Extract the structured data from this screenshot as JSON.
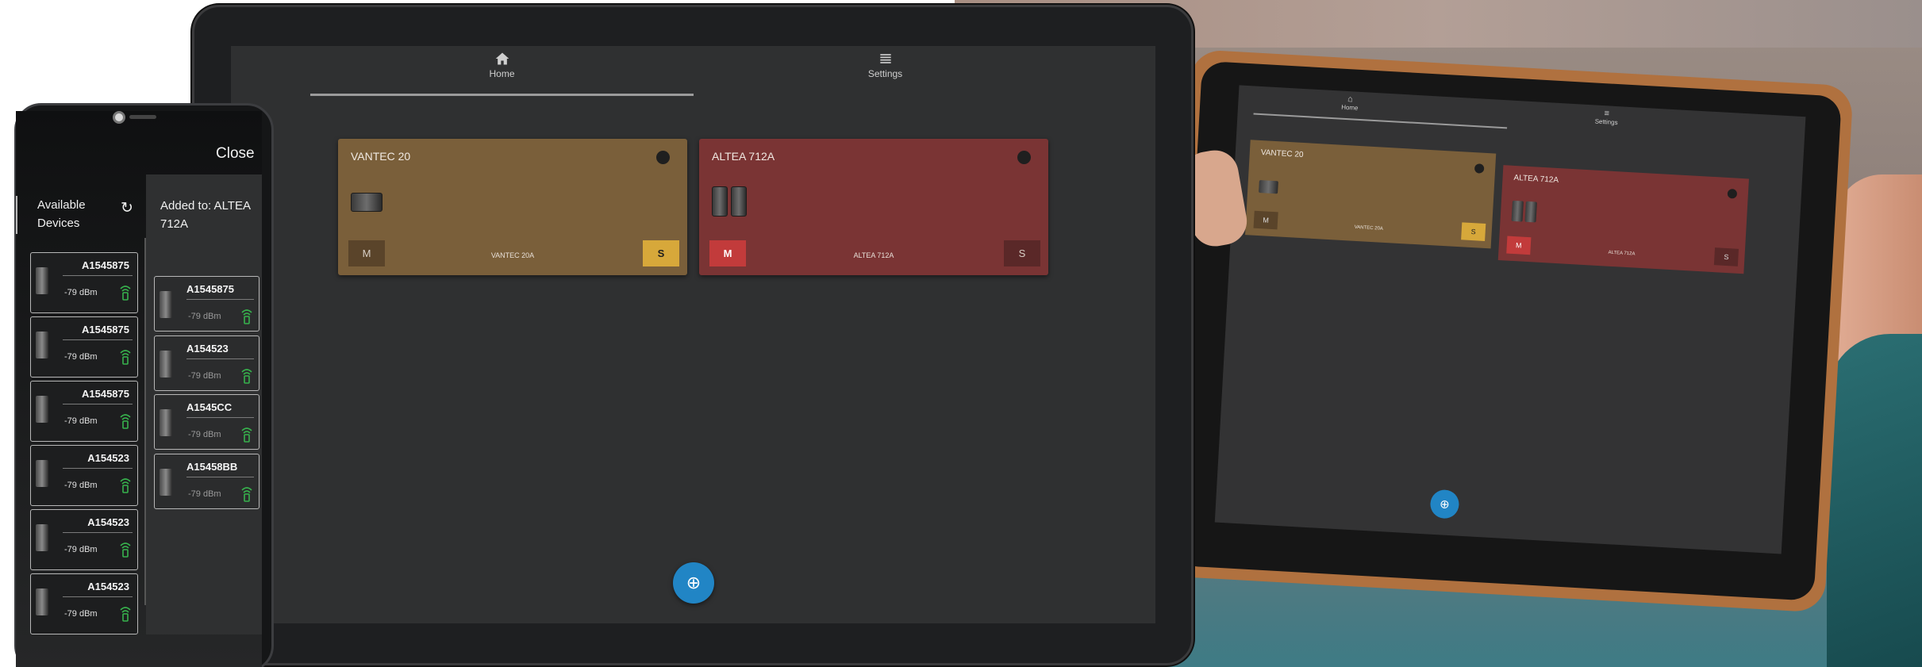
{
  "tablet": {
    "tabs": [
      {
        "label": "Home",
        "icon": "home-icon"
      },
      {
        "label": "Settings",
        "icon": "menu-icon"
      }
    ],
    "cards": [
      {
        "title": "VANTEC 20",
        "subtitle": "VANTEC 20A",
        "mute_label": "M",
        "solo_label": "S",
        "color": "#7a5f3a",
        "mute_color": "#5a442a",
        "solo_color": "#d7a83a"
      },
      {
        "title": "ALTEA 712A",
        "subtitle": "ALTEA 712A",
        "mute_label": "M",
        "solo_label": "S",
        "color": "#7a3434",
        "mute_color": "#c23b3b",
        "solo_color": "#5a2828"
      }
    ],
    "fab_icon": "add-circle-icon"
  },
  "tablet2": {
    "tabs": [
      {
        "label": "Home"
      },
      {
        "label": "Settings"
      }
    ],
    "cards": [
      {
        "title": "VANTEC 20",
        "subtitle": "VANTEC 20A",
        "mute_label": "M",
        "solo_label": "S"
      },
      {
        "title": "ALTEA 712A",
        "subtitle": "ALTEA 712A",
        "mute_label": "M",
        "solo_label": "S"
      }
    ]
  },
  "phone": {
    "close_label": "Close",
    "available_heading": "Available\nDevices",
    "added_heading": "Added to: ALTEA\n712A",
    "available_devices": [
      {
        "name": "A1545875",
        "signal": "-79 dBm"
      },
      {
        "name": "A1545875",
        "signal": "-79 dBm"
      },
      {
        "name": "A1545875",
        "signal": "-79 dBm"
      },
      {
        "name": "A154523",
        "signal": "-79 dBm"
      },
      {
        "name": "A154523",
        "signal": "-79 dBm"
      },
      {
        "name": "A154523",
        "signal": "-79 dBm"
      }
    ],
    "added_devices": [
      {
        "name": "A1545875",
        "signal": "-79 dBm"
      },
      {
        "name": "A154523",
        "signal": "-79 dBm"
      },
      {
        "name": "A1545CC",
        "signal": "-79 dBm"
      },
      {
        "name": "A15458BB",
        "signal": "-79 dBm"
      }
    ]
  }
}
